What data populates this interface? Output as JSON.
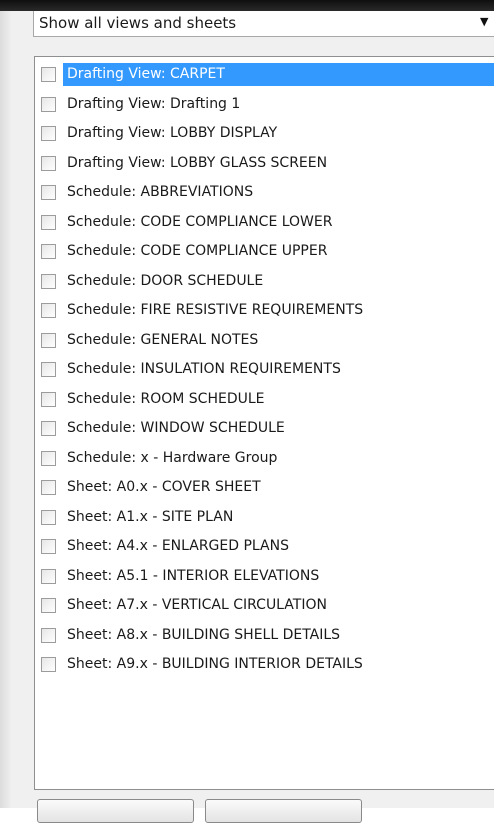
{
  "filter": {
    "selected": "Show all views and sheets",
    "arrow_icon": "chevron-down-icon"
  },
  "list": {
    "items": [
      {
        "label": "Drafting View: CARPET",
        "checked": false,
        "selected": true
      },
      {
        "label": "Drafting View: Drafting 1",
        "checked": false,
        "selected": false
      },
      {
        "label": "Drafting View: LOBBY DISPLAY",
        "checked": false,
        "selected": false
      },
      {
        "label": "Drafting View: LOBBY GLASS SCREEN",
        "checked": false,
        "selected": false
      },
      {
        "label": "Schedule: ABBREVIATIONS",
        "checked": false,
        "selected": false
      },
      {
        "label": "Schedule: CODE COMPLIANCE LOWER",
        "checked": false,
        "selected": false
      },
      {
        "label": "Schedule: CODE COMPLIANCE UPPER",
        "checked": false,
        "selected": false
      },
      {
        "label": "Schedule: DOOR SCHEDULE",
        "checked": false,
        "selected": false
      },
      {
        "label": "Schedule: FIRE RESISTIVE REQUIREMENTS",
        "checked": false,
        "selected": false
      },
      {
        "label": "Schedule: GENERAL NOTES",
        "checked": false,
        "selected": false
      },
      {
        "label": "Schedule: INSULATION REQUIREMENTS",
        "checked": false,
        "selected": false
      },
      {
        "label": "Schedule: ROOM SCHEDULE",
        "checked": false,
        "selected": false
      },
      {
        "label": "Schedule: WINDOW SCHEDULE",
        "checked": false,
        "selected": false
      },
      {
        "label": "Schedule: x - Hardware Group",
        "checked": false,
        "selected": false
      },
      {
        "label": "Sheet: A0.x - COVER SHEET",
        "checked": false,
        "selected": false
      },
      {
        "label": "Sheet: A1.x - SITE PLAN",
        "checked": false,
        "selected": false
      },
      {
        "label": "Sheet: A4.x - ENLARGED PLANS",
        "checked": false,
        "selected": false
      },
      {
        "label": "Sheet: A5.1 - INTERIOR ELEVATIONS",
        "checked": false,
        "selected": false
      },
      {
        "label": "Sheet: A7.x - VERTICAL CIRCULATION",
        "checked": false,
        "selected": false
      },
      {
        "label": "Sheet: A8.x - BUILDING SHELL DETAILS",
        "checked": false,
        "selected": false
      },
      {
        "label": "Sheet: A9.x - BUILDING INTERIOR DETAILS",
        "checked": false,
        "selected": false
      }
    ]
  },
  "colors": {
    "selection": "#3399ff",
    "window_bg": "#f0f0f0"
  }
}
